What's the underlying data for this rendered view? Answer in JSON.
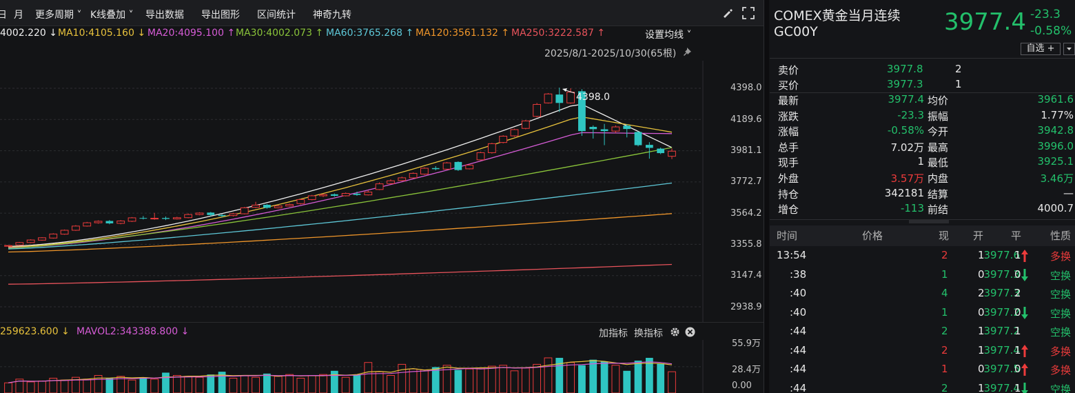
{
  "toolbar": {
    "items": [
      "月",
      "更多周期 ˅",
      "K线叠加 ˅",
      "导出数据",
      "导出图形",
      "区间统计",
      "神奇九转"
    ],
    "cut_item": "日"
  },
  "ma_legend": [
    {
      "text": "4002.220 ↓",
      "color": "#f0f0f0"
    },
    {
      "text": "MA10:4105.160 ↓",
      "color": "#e8c23c"
    },
    {
      "text": "MA20:4095.100 ↑",
      "color": "#d65cd6"
    },
    {
      "text": "MA30:4002.073 ↑",
      "color": "#8ac43a"
    },
    {
      "text": "MA60:3765.268 ↑",
      "color": "#5ec8d8"
    },
    {
      "text": "MA120:3561.132 ↑",
      "color": "#f0962a"
    },
    {
      "text": "MA250:3222.587 ↑",
      "color": "#e8535b"
    }
  ],
  "settings_label": "设置均线 ˅",
  "range_label": "2025/8/1-2025/10/30(65根)",
  "peak_label": "4398.0",
  "price_axis": [
    "4398.0",
    "4189.6",
    "3981.1",
    "3772.7",
    "3564.2",
    "3355.8",
    "3147.4",
    "2938.9"
  ],
  "vol_legend": [
    {
      "text": "259623.600 ↓",
      "color": "#e8c23c"
    },
    {
      "text": "MAVOL2:343388.800 ↓",
      "color": "#d65cd6"
    }
  ],
  "vol_controls": {
    "add": "加指标",
    "switch": "换指标"
  },
  "vol_axis": [
    "55.9万",
    "28.4万",
    "0.00"
  ],
  "colors": {
    "up": "#ec3b3b",
    "down": "#2fc5c2",
    "green": "#23c06b",
    "bg": "#131416"
  },
  "instrument": {
    "name": "COMEX黄金当月连续",
    "code": "GC00Y",
    "price": "3977.4",
    "change": "-23.3",
    "change_pct": "-0.58%",
    "watch_btn": "自选 +"
  },
  "quote": {
    "sell": {
      "label": "卖价",
      "price": "3977.8",
      "qty": "2"
    },
    "buy": {
      "label": "买价",
      "price": "3977.3",
      "qty": "1"
    },
    "rows": [
      {
        "l1": "最新",
        "v1": "3977.4",
        "c1": "green",
        "l2": "均价",
        "v2": "3961.6",
        "c2": "green"
      },
      {
        "l1": "涨跌",
        "v1": "-23.3",
        "c1": "green",
        "l2": "振幅",
        "v2": "1.77%",
        "c2": "white"
      },
      {
        "l1": "涨幅",
        "v1": "-0.58%",
        "c1": "green",
        "l2": "今开",
        "v2": "3942.8",
        "c2": "green"
      },
      {
        "l1": "总手",
        "v1": "7.02万",
        "c1": "white",
        "l2": "最高",
        "v2": "3996.0",
        "c2": "green"
      },
      {
        "l1": "现手",
        "v1": "1",
        "c1": "white",
        "l2": "最低",
        "v2": "3925.1",
        "c2": "green"
      },
      {
        "l1": "外盘",
        "v1": "3.57万",
        "c1": "red",
        "l2": "内盘",
        "v2": "3.46万",
        "c2": "green"
      },
      {
        "l1": "持仓",
        "v1": "342181",
        "c1": "white",
        "l2": "结算",
        "v2": "—",
        "c2": "white"
      },
      {
        "l1": "增仓",
        "v1": "-113",
        "c1": "green",
        "l2": "前结",
        "v2": "4000.7",
        "c2": "white"
      }
    ]
  },
  "trades": {
    "headers": [
      "时间",
      "价格",
      "现",
      "开",
      "平",
      "性质"
    ],
    "rows": [
      {
        "time": "13:54",
        "price": "3977.6",
        "dir": "up",
        "vol": "2",
        "vc": "red",
        "open": "1",
        "close": "1",
        "nature": "多换",
        "nc": "red"
      },
      {
        "time": ":38",
        "price": "3977.3",
        "dir": "down",
        "vol": "1",
        "vc": "green",
        "open": "0",
        "close": "0",
        "nature": "空换",
        "nc": "green"
      },
      {
        "time": ":40",
        "price": "3977.3",
        "dir": "",
        "vol": "4",
        "vc": "green",
        "open": "2",
        "close": "2",
        "nature": "空换",
        "nc": "green"
      },
      {
        "time": ":40",
        "price": "3977.2",
        "dir": "down",
        "vol": "1",
        "vc": "green",
        "open": "0",
        "close": "0",
        "nature": "空换",
        "nc": "green"
      },
      {
        "time": ":44",
        "price": "3977.2",
        "dir": "",
        "vol": "2",
        "vc": "green",
        "open": "1",
        "close": "1",
        "nature": "空换",
        "nc": "green"
      },
      {
        "time": ":44",
        "price": "3977.4",
        "dir": "up",
        "vol": "2",
        "vc": "red",
        "open": "1",
        "close": "1",
        "nature": "多换",
        "nc": "red"
      },
      {
        "time": ":44",
        "price": "3977.5",
        "dir": "up",
        "vol": "1",
        "vc": "red",
        "open": "0",
        "close": "0",
        "nature": "多换",
        "nc": "red"
      },
      {
        "time": ":44",
        "price": "3977.4",
        "dir": "down",
        "vol": "2",
        "vc": "green",
        "open": "1",
        "close": "1",
        "nature": "空换",
        "nc": "green"
      }
    ]
  },
  "chart_data": {
    "type": "candlestick",
    "ylim": [
      2938.9,
      4398.0
    ],
    "candles": [
      {
        "o": 3346,
        "c": 3348,
        "h": 3351,
        "l": 3343
      },
      {
        "o": 3352,
        "c": 3368,
        "h": 3372,
        "l": 3348
      },
      {
        "o": 3368,
        "c": 3385,
        "h": 3390,
        "l": 3364
      },
      {
        "o": 3384,
        "c": 3400,
        "h": 3404,
        "l": 3380
      },
      {
        "o": 3398,
        "c": 3425,
        "h": 3430,
        "l": 3394
      },
      {
        "o": 3424,
        "c": 3450,
        "h": 3455,
        "l": 3420
      },
      {
        "o": 3450,
        "c": 3478,
        "h": 3484,
        "l": 3446
      },
      {
        "o": 3478,
        "c": 3500,
        "h": 3506,
        "l": 3474
      },
      {
        "o": 3500,
        "c": 3510,
        "h": 3516,
        "l": 3494
      },
      {
        "o": 3512,
        "c": 3496,
        "h": 3518,
        "l": 3490
      },
      {
        "o": 3496,
        "c": 3512,
        "h": 3518,
        "l": 3490
      },
      {
        "o": 3510,
        "c": 3533,
        "h": 3538,
        "l": 3505
      },
      {
        "o": 3532,
        "c": 3528,
        "h": 3545,
        "l": 3522
      },
      {
        "o": 3526,
        "c": 3530,
        "h": 3566,
        "l": 3520
      },
      {
        "o": 3532,
        "c": 3526,
        "h": 3542,
        "l": 3518
      },
      {
        "o": 3526,
        "c": 3534,
        "h": 3540,
        "l": 3522
      },
      {
        "o": 3534,
        "c": 3555,
        "h": 3562,
        "l": 3530
      },
      {
        "o": 3555,
        "c": 3565,
        "h": 3570,
        "l": 3550
      },
      {
        "o": 3568,
        "c": 3552,
        "h": 3572,
        "l": 3544
      },
      {
        "o": 3552,
        "c": 3545,
        "h": 3558,
        "l": 3536
      },
      {
        "o": 3548,
        "c": 3560,
        "h": 3566,
        "l": 3542
      },
      {
        "o": 3560,
        "c": 3600,
        "h": 3606,
        "l": 3556
      },
      {
        "o": 3603,
        "c": 3618,
        "h": 3640,
        "l": 3598
      },
      {
        "o": 3620,
        "c": 3600,
        "h": 3625,
        "l": 3594
      },
      {
        "o": 3600,
        "c": 3612,
        "h": 3618,
        "l": 3596
      },
      {
        "o": 3612,
        "c": 3622,
        "h": 3628,
        "l": 3608
      },
      {
        "o": 3628,
        "c": 3655,
        "h": 3660,
        "l": 3622
      },
      {
        "o": 3655,
        "c": 3680,
        "h": 3686,
        "l": 3650
      },
      {
        "o": 3680,
        "c": 3688,
        "h": 3694,
        "l": 3672
      },
      {
        "o": 3690,
        "c": 3680,
        "h": 3696,
        "l": 3674
      },
      {
        "o": 3680,
        "c": 3696,
        "h": 3702,
        "l": 3676
      },
      {
        "o": 3694,
        "c": 3686,
        "h": 3708,
        "l": 3680
      },
      {
        "o": 3686,
        "c": 3705,
        "h": 3714,
        "l": 3682
      },
      {
        "o": 3722,
        "c": 3760,
        "h": 3770,
        "l": 3718
      },
      {
        "o": 3762,
        "c": 3780,
        "h": 3790,
        "l": 3756
      },
      {
        "o": 3782,
        "c": 3800,
        "h": 3808,
        "l": 3778
      },
      {
        "o": 3800,
        "c": 3830,
        "h": 3836,
        "l": 3796
      },
      {
        "o": 3825,
        "c": 3864,
        "h": 3870,
        "l": 3820
      },
      {
        "o": 3865,
        "c": 3858,
        "h": 3878,
        "l": 3850
      },
      {
        "o": 3858,
        "c": 3900,
        "h": 3906,
        "l": 3854
      },
      {
        "o": 3906,
        "c": 3852,
        "h": 3910,
        "l": 3846
      },
      {
        "o": 3860,
        "c": 3885,
        "h": 3892,
        "l": 3856
      },
      {
        "o": 3920,
        "c": 3968,
        "h": 3974,
        "l": 3916
      },
      {
        "o": 3968,
        "c": 4028,
        "h": 4034,
        "l": 3962
      },
      {
        "o": 4036,
        "c": 4078,
        "h": 4084,
        "l": 4030
      },
      {
        "o": 4080,
        "c": 4122,
        "h": 4128,
        "l": 4074
      },
      {
        "o": 4130,
        "c": 4180,
        "h": 4186,
        "l": 4124
      },
      {
        "o": 4210,
        "c": 4290,
        "h": 4300,
        "l": 4204
      },
      {
        "o": 4300,
        "c": 4360,
        "h": 4366,
        "l": 4296
      },
      {
        "o": 4356,
        "c": 4300,
        "h": 4402,
        "l": 4240
      },
      {
        "o": 4300,
        "c": 4372,
        "h": 4398,
        "l": 4294
      },
      {
        "o": 4378,
        "c": 4112,
        "h": 4392,
        "l": 4080
      },
      {
        "o": 4140,
        "c": 4125,
        "h": 4150,
        "l": 4062
      },
      {
        "o": 4124,
        "c": 4112,
        "h": 4160,
        "l": 4018
      },
      {
        "o": 4112,
        "c": 4140,
        "h": 4150,
        "l": 4100
      },
      {
        "o": 4148,
        "c": 4126,
        "h": 4158,
        "l": 4070
      },
      {
        "o": 4106,
        "c": 4018,
        "h": 4110,
        "l": 4010
      },
      {
        "o": 4020,
        "c": 4000,
        "h": 4038,
        "l": 3928
      },
      {
        "o": 3995,
        "c": 3965,
        "h": 4002,
        "l": 3958
      },
      {
        "o": 3944,
        "c": 3978,
        "h": 3996,
        "l": 3925
      }
    ],
    "ma_lines": [
      {
        "name": "MA5",
        "color": "#f0f0f0",
        "start": 3342,
        "end": 4002,
        "peak": 4300
      },
      {
        "name": "MA10",
        "color": "#e8c23c",
        "start": 3338,
        "end": 4105,
        "peak": 4210
      },
      {
        "name": "MA20",
        "color": "#d65cd6",
        "start": 3334,
        "end": 4095,
        "peak": 4102
      },
      {
        "name": "MA30",
        "color": "#8ac43a",
        "start": 3330,
        "end": 4002,
        "peak": 4002
      },
      {
        "name": "MA60",
        "color": "#5ec8d8",
        "start": 3325,
        "end": 3765,
        "peak": 3765
      },
      {
        "name": "MA120",
        "color": "#f0962a",
        "start": 3305,
        "end": 3561,
        "peak": 3561
      },
      {
        "name": "MA250",
        "color": "#e8535b",
        "start": 3090,
        "end": 3222,
        "peak": 3222
      }
    ],
    "volume": {
      "ylim": [
        0,
        559000
      ],
      "values": [
        110000,
        150000,
        120000,
        130000,
        160000,
        140000,
        170000,
        150000,
        190000,
        160000,
        180000,
        140000,
        170000,
        150000,
        220000,
        190000,
        180000,
        170000,
        200000,
        230000,
        160000,
        190000,
        170000,
        210000,
        180000,
        200000,
        160000,
        190000,
        200000,
        240000,
        170000,
        200000,
        330000,
        230000,
        190000,
        310000,
        260000,
        250000,
        280000,
        300000,
        250000,
        260000,
        270000,
        290000,
        300000,
        240000,
        270000,
        310000,
        380000,
        380000,
        330000,
        300000,
        360000,
        340000,
        300000,
        240000,
        350000,
        380000,
        320000,
        230000
      ]
    }
  }
}
